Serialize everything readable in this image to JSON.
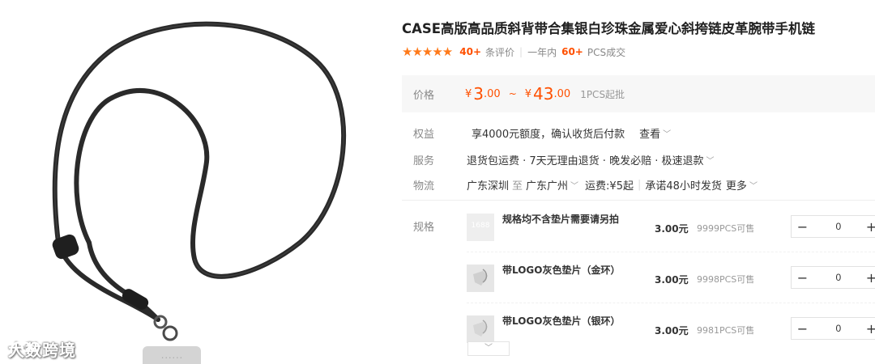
{
  "product": {
    "title": "CASE高版高品质斜背带合集银白珍珠金属爱心斜挎链皮革腕带手机链",
    "rating_stars": "★★★★★",
    "review_count": "40+",
    "review_label": "条评价",
    "period_label": "一年内",
    "deal_count": "60+",
    "deal_label": "PCS成交"
  },
  "price": {
    "label": "价格",
    "currency": "¥",
    "low_int": "3",
    "low_dec": ".00",
    "tilde": "~",
    "high_int": "43",
    "high_dec": ".00",
    "moq": "1PCS起批"
  },
  "rights": {
    "label": "权益",
    "text": "享4000元额度，确认收货后付款",
    "link": "查看"
  },
  "service": {
    "label": "服务",
    "text": "退货包运费 · 7天无理由退货 · 晚发必赔 · 极速退款"
  },
  "logistics": {
    "label": "物流",
    "from": "广东深圳",
    "to_word": "至",
    "to": "广东广州",
    "freight": "运费:¥5起",
    "promise": "承诺48小时发货",
    "more": "更多"
  },
  "specs": {
    "label": "规格",
    "items": [
      {
        "name": "规格均不含垫片需要请另拍",
        "price": "3.00元",
        "stock": "9999PCS可售",
        "qty": "0",
        "thumb_text": "1688"
      },
      {
        "name": "带LOGO灰色垫片（金环）",
        "price": "3.00元",
        "stock": "9998PCS可售",
        "qty": "0",
        "thumb_text": ""
      },
      {
        "name": "带LOGO灰色垫片（银环）",
        "price": "3.00元",
        "stock": "9981PCS可售",
        "qty": "0",
        "thumb_text": ""
      }
    ],
    "minus": "−",
    "plus": "+"
  },
  "icons": {
    "chevron": "chevron-down-icon",
    "expand": "expand-down-icon"
  },
  "watermark": {
    "text": "大数跨境"
  },
  "colors": {
    "accent": "#ff5000",
    "star": "#ff7a1a",
    "price_bg": "#f7f7f7"
  }
}
